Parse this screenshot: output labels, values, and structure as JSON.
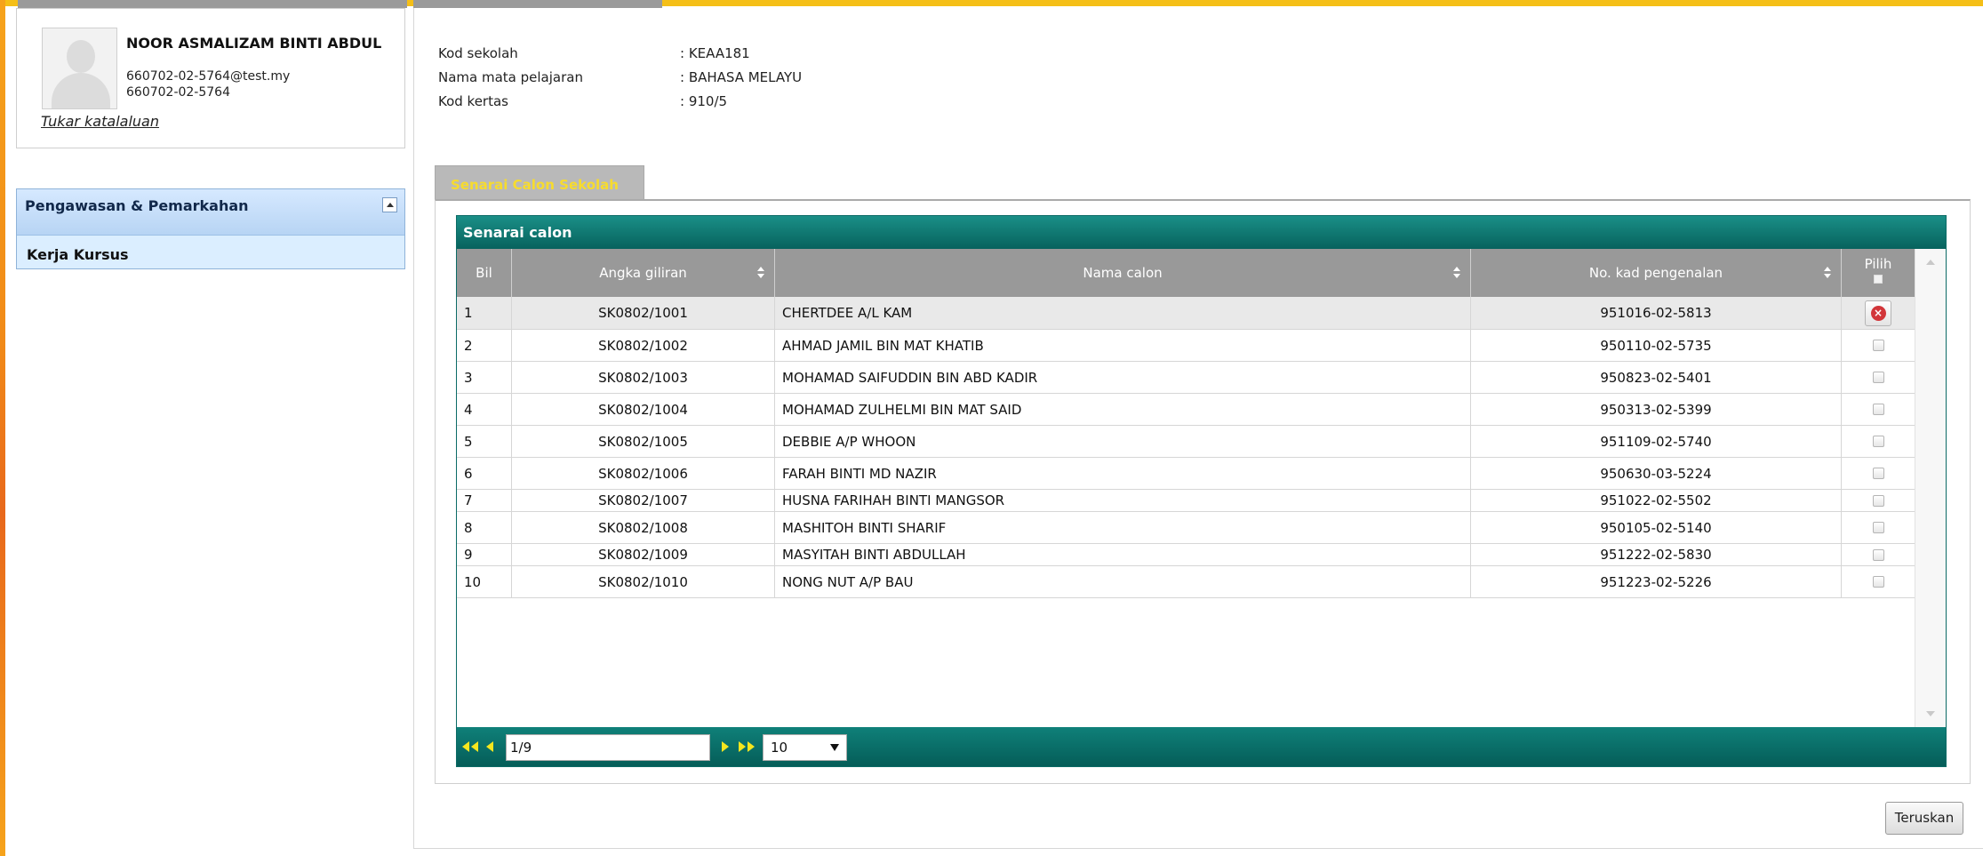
{
  "user": {
    "name": "NOOR ASMALIZAM BINTI ABDUL",
    "email": "660702-02-5764@test.my",
    "ic": "660702-02-5764",
    "change_password_label": "Tukar katalaluan"
  },
  "menu": {
    "header": "Pengawasan & Pemarkahan",
    "items": [
      "Kerja Kursus"
    ]
  },
  "info": [
    {
      "label": "Kod sekolah",
      "value": ": KEAA181"
    },
    {
      "label": "Nama mata pelajaran",
      "value": ": BAHASA MELAYU"
    },
    {
      "label": "Kod kertas",
      "value": ": 910/5"
    }
  ],
  "tab": {
    "label": "Senarai Calon Sekolah"
  },
  "grid": {
    "caption": "Senarai calon",
    "columns": {
      "bil": "Bil",
      "angka": "Angka giliran",
      "nama": "Nama calon",
      "ic": "No. kad pengenalan",
      "pilih": "Pilih"
    },
    "rows": [
      {
        "bil": "1",
        "angka": "SK0802/1001",
        "nama": "CHERTDEE A/L KAM",
        "ic": "951016-02-5813",
        "selected": true
      },
      {
        "bil": "2",
        "angka": "SK0802/1002",
        "nama": "AHMAD JAMIL BIN MAT KHATIB",
        "ic": "950110-02-5735",
        "selected": false
      },
      {
        "bil": "3",
        "angka": "SK0802/1003",
        "nama": "MOHAMAD SAIFUDDIN BIN ABD KADIR",
        "ic": "950823-02-5401",
        "selected": false
      },
      {
        "bil": "4",
        "angka": "SK0802/1004",
        "nama": "MOHAMAD ZULHELMI BIN MAT SAID",
        "ic": "950313-02-5399",
        "selected": false
      },
      {
        "bil": "5",
        "angka": "SK0802/1005",
        "nama": "DEBBIE A/P WHOON",
        "ic": "951109-02-5740",
        "selected": false
      },
      {
        "bil": "6",
        "angka": "SK0802/1006",
        "nama": "FARAH BINTI MD NAZIR",
        "ic": "950630-03-5224",
        "selected": false
      },
      {
        "bil": "7",
        "angka": "SK0802/1007",
        "nama": "HUSNA FARIHAH BINTI MANGSOR",
        "ic": "951022-02-5502",
        "selected": false
      },
      {
        "bil": "8",
        "angka": "SK0802/1008",
        "nama": "MASHITOH BINTI SHARIF",
        "ic": "950105-02-5140",
        "selected": false
      },
      {
        "bil": "9",
        "angka": "SK0802/1009",
        "nama": "MASYITAH BINTI ABDULLAH",
        "ic": "951222-02-5830",
        "selected": false
      },
      {
        "bil": "10",
        "angka": "SK0802/1010",
        "nama": "NONG NUT A/P BAU",
        "ic": "951223-02-5226",
        "selected": false
      }
    ]
  },
  "pager": {
    "page": "1/9",
    "page_size": "10"
  },
  "actions": {
    "next_label": "Teruskan"
  },
  "colors": {
    "accent_top": "#f5bf17",
    "grid_header": "#0a6e68",
    "tab_text": "#f7dc2d",
    "menu_bg": "#dbeeff"
  }
}
